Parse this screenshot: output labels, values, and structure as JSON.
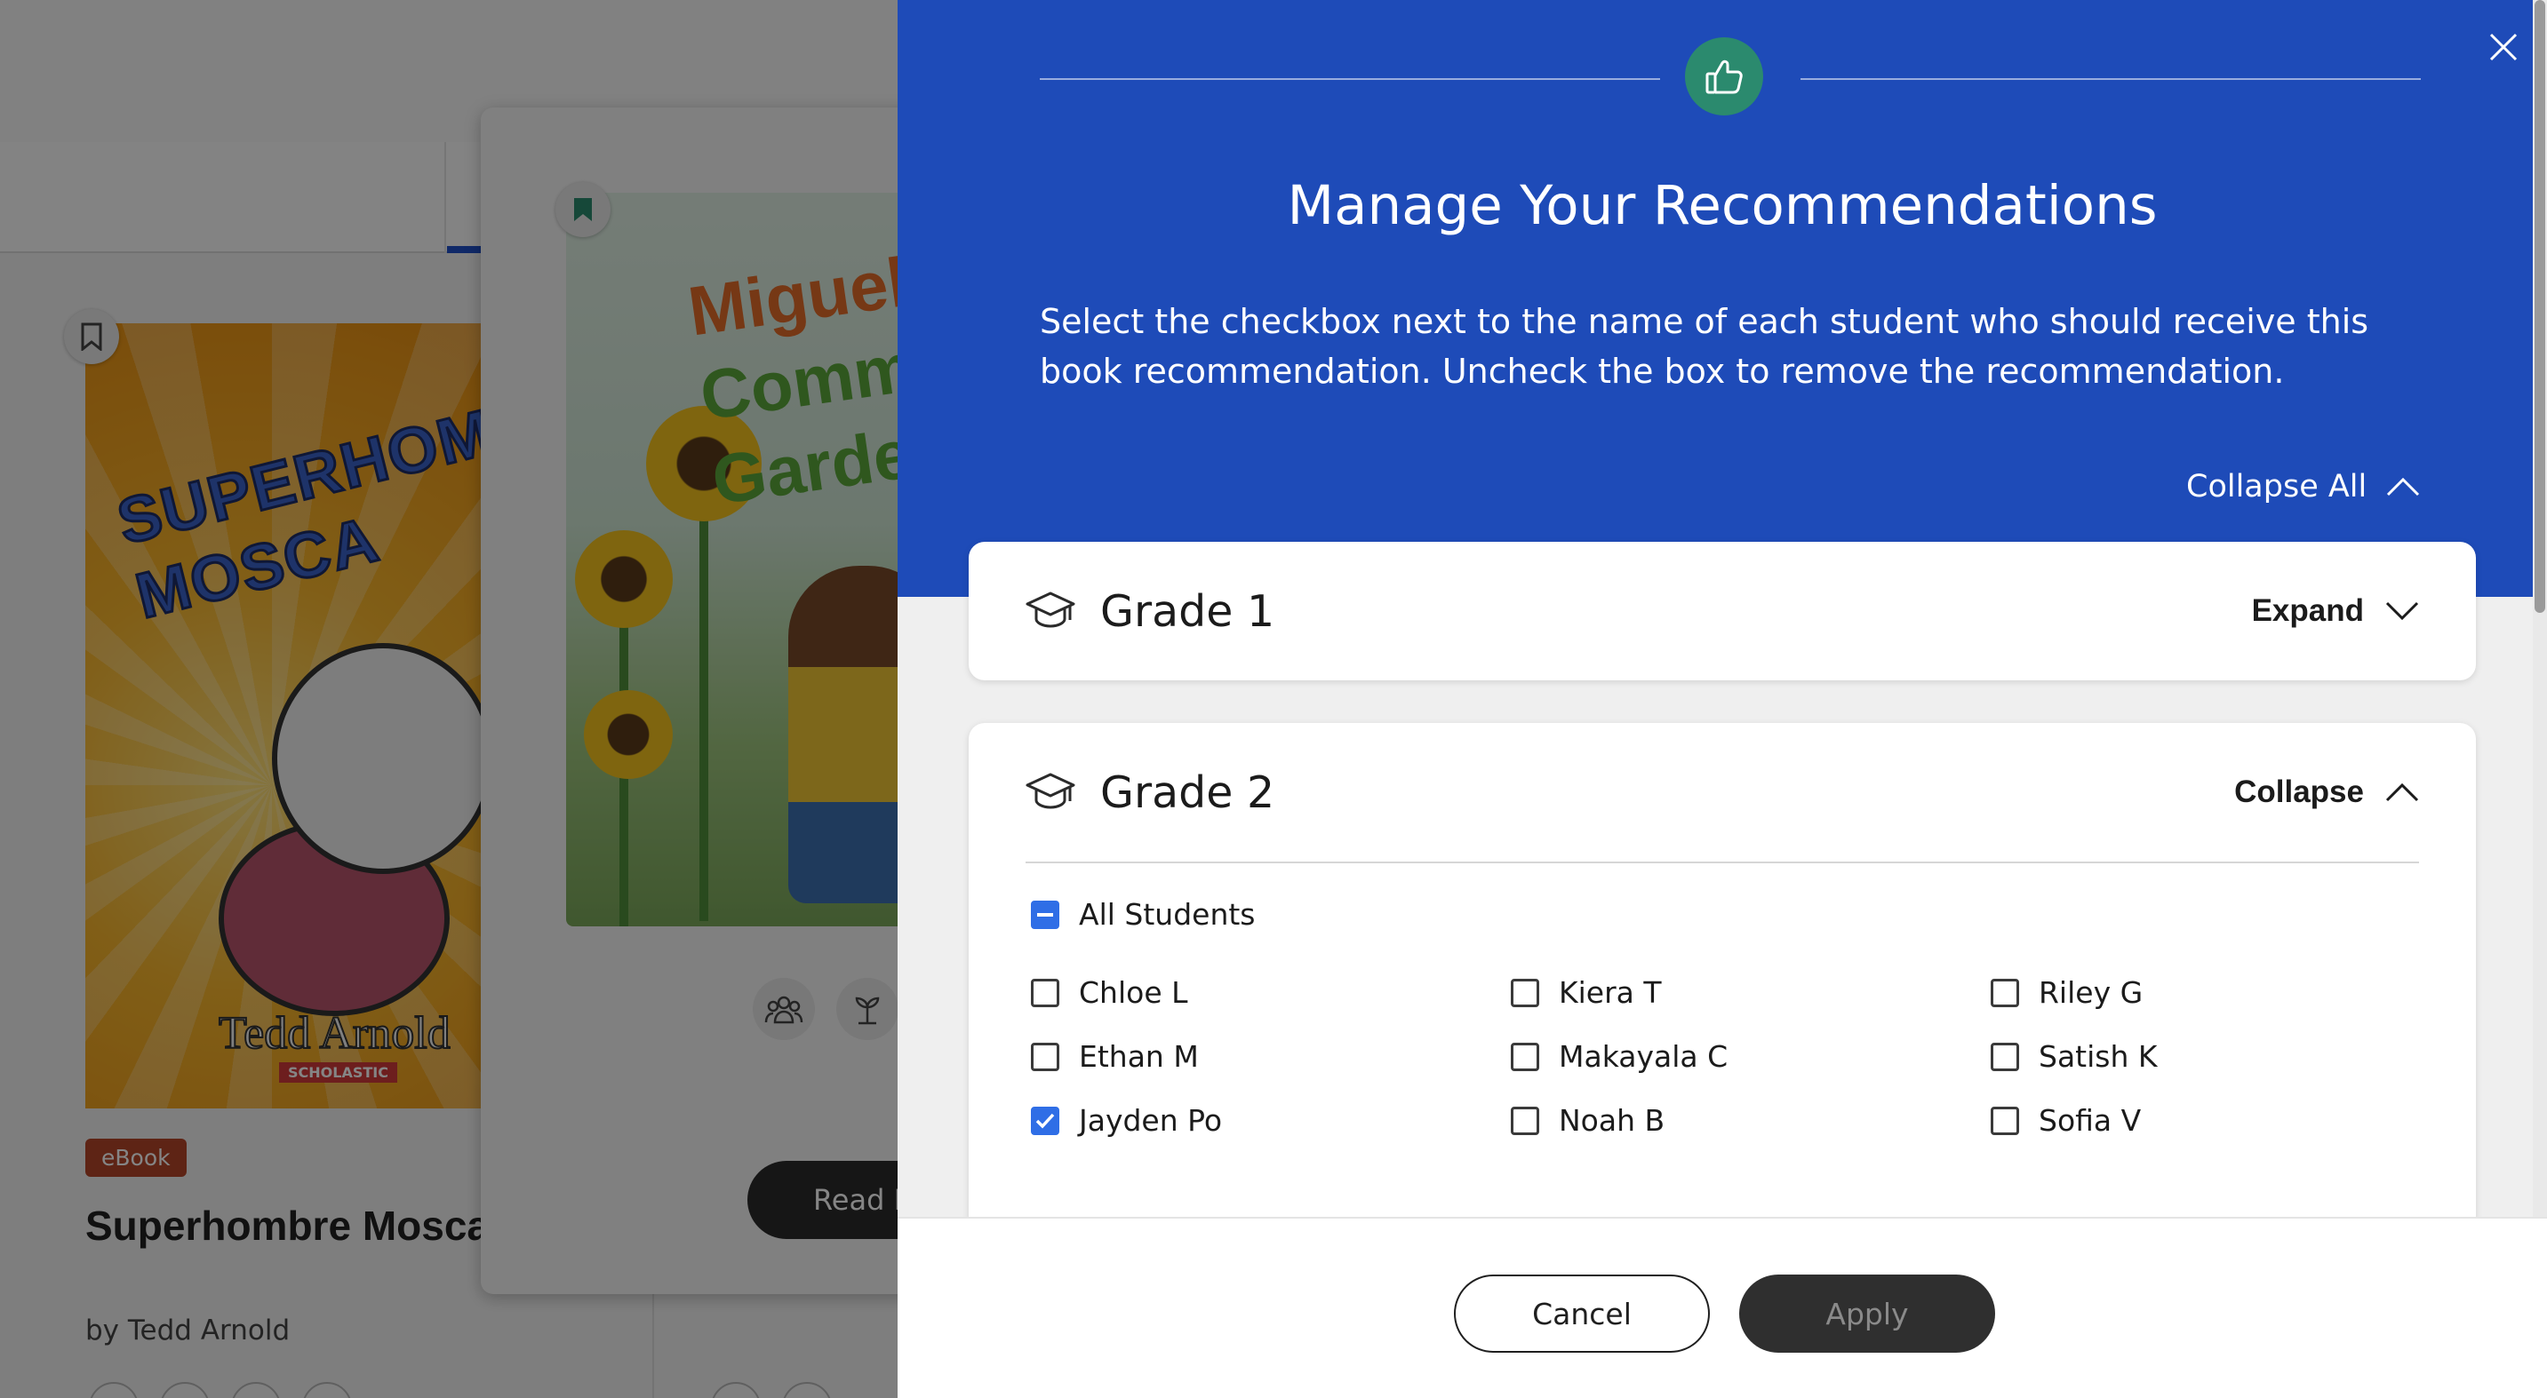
{
  "background": {
    "book1": {
      "cover_title": "SUPERHOMBRE MOSCA",
      "cover_author": "Tedd Arnold",
      "cover_publisher": "SCHOLASTIC",
      "format_badge": "eBook",
      "title": "Superhombre Mosca (Super Fly Guy!)",
      "author": "by Tedd Arnold"
    },
    "book2": {
      "cover_title_line1": "Miguel",
      "cover_title_line2": "Communi",
      "cover_title_line3": "Garden",
      "read_button": "Read It"
    }
  },
  "modal": {
    "icon": "thumbs-up-icon",
    "title": "Manage Your Recommendations",
    "description": "Select the checkbox next to the name of each student who should receive this book recommendation. Uncheck the box to remove the recommendation.",
    "collapse_all_label": "Collapse All",
    "grades": [
      {
        "name": "Grade 1",
        "toggle_label": "Expand",
        "expanded": false
      },
      {
        "name": "Grade 2",
        "toggle_label": "Collapse",
        "expanded": true,
        "all_students_label": "All Students",
        "all_students_state": "indeterminate",
        "students": [
          {
            "name": "Chloe L",
            "checked": false
          },
          {
            "name": "Kiera T",
            "checked": false
          },
          {
            "name": "Riley G",
            "checked": false
          },
          {
            "name": "Ethan M",
            "checked": false
          },
          {
            "name": "Makayala C",
            "checked": false
          },
          {
            "name": "Satish K",
            "checked": false
          },
          {
            "name": "Jayden Po",
            "checked": true
          },
          {
            "name": "Noah B",
            "checked": false
          },
          {
            "name": "Sofia V",
            "checked": false
          }
        ]
      }
    ],
    "footer": {
      "cancel_label": "Cancel",
      "apply_label": "Apply",
      "apply_enabled": false
    }
  },
  "colors": {
    "header_blue": "#1e4bb8",
    "badge_green": "#2b8a6e",
    "checkbox_blue": "#2f6ee6",
    "ebook_badge": "#b4462a"
  }
}
